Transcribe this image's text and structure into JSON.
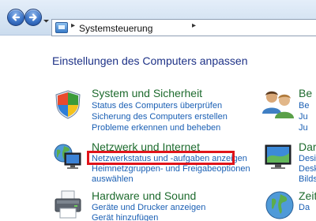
{
  "navbar": {
    "back_icon": "back-arrow-icon",
    "forward_icon": "forward-arrow-icon",
    "address": {
      "separator": "▸",
      "path": "Systemsteuerung",
      "separator_after": "▸"
    }
  },
  "main": {
    "title": "Einstellungen des Computers anpassen",
    "categories": [
      {
        "title": "System und Sicherheit",
        "icon": "shield-icon",
        "links": [
          "Status des Computers überprüfen",
          "Sicherung des Computers erstellen",
          "Probleme erkennen und beheben"
        ]
      },
      {
        "title": "Netzwerk und Internet",
        "icon": "network-globe-icon",
        "links": [
          "Netzwerkstatus und -aufgaben anzeigen",
          "Heimnetzgruppen- und Freigabeoptionen",
          "auswählen"
        ]
      },
      {
        "title": "Hardware und Sound",
        "icon": "printer-icon",
        "links": [
          "Geräte und Drucker anzeigen",
          "Gerät hinzufügen"
        ]
      }
    ],
    "right_column": {
      "items": [
        {
          "title": "Be",
          "icon": "users-icon",
          "links": [
            "Be",
            "Ju",
            "Ju"
          ]
        },
        {
          "title": "Dars",
          "icon": "display-icon",
          "links": [
            "Desig",
            "Desk",
            "Bilds"
          ]
        },
        {
          "title": "Zeit",
          "icon": "clock-globe-icon",
          "links": [
            "Da"
          ]
        }
      ]
    }
  },
  "colors": {
    "title_blue": "#1e3287",
    "category_green": "#1e6b2e",
    "link_blue": "#1a5fb4",
    "highlight_red": "#e0141a"
  }
}
